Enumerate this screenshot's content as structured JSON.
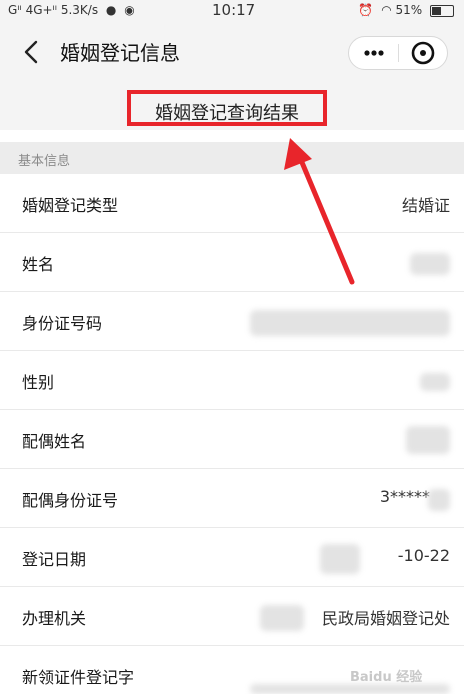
{
  "status_bar": {
    "left": "Gᴵᴵ 4G+ᴵᴵ 5.3K/s",
    "time": "10:17",
    "battery": "51%",
    "battery_level": 0.51
  },
  "nav": {
    "title": "婚姻登记信息"
  },
  "result": {
    "title": "婚姻登记查询结果"
  },
  "section": {
    "title": "基本信息"
  },
  "rows": [
    {
      "label": "婚姻登记类型",
      "value": "结婚证"
    },
    {
      "label": "姓名",
      "value": ""
    },
    {
      "label": "身份证号码",
      "value": ""
    },
    {
      "label": "性别",
      "value": ""
    },
    {
      "label": "配偶姓名",
      "value": ""
    },
    {
      "label": "配偶身份证号",
      "value": "3*****"
    },
    {
      "label": "登记日期",
      "value": "-10-22"
    },
    {
      "label": "办理机关",
      "value": "民政局婚姻登记处"
    },
    {
      "label": "新领证件登记字",
      "value": ""
    }
  ],
  "watermark": "Baidu 经验",
  "colors": {
    "highlight": "#e8252b",
    "background": "#f4f4f4",
    "separator": "#e9e9e9"
  }
}
